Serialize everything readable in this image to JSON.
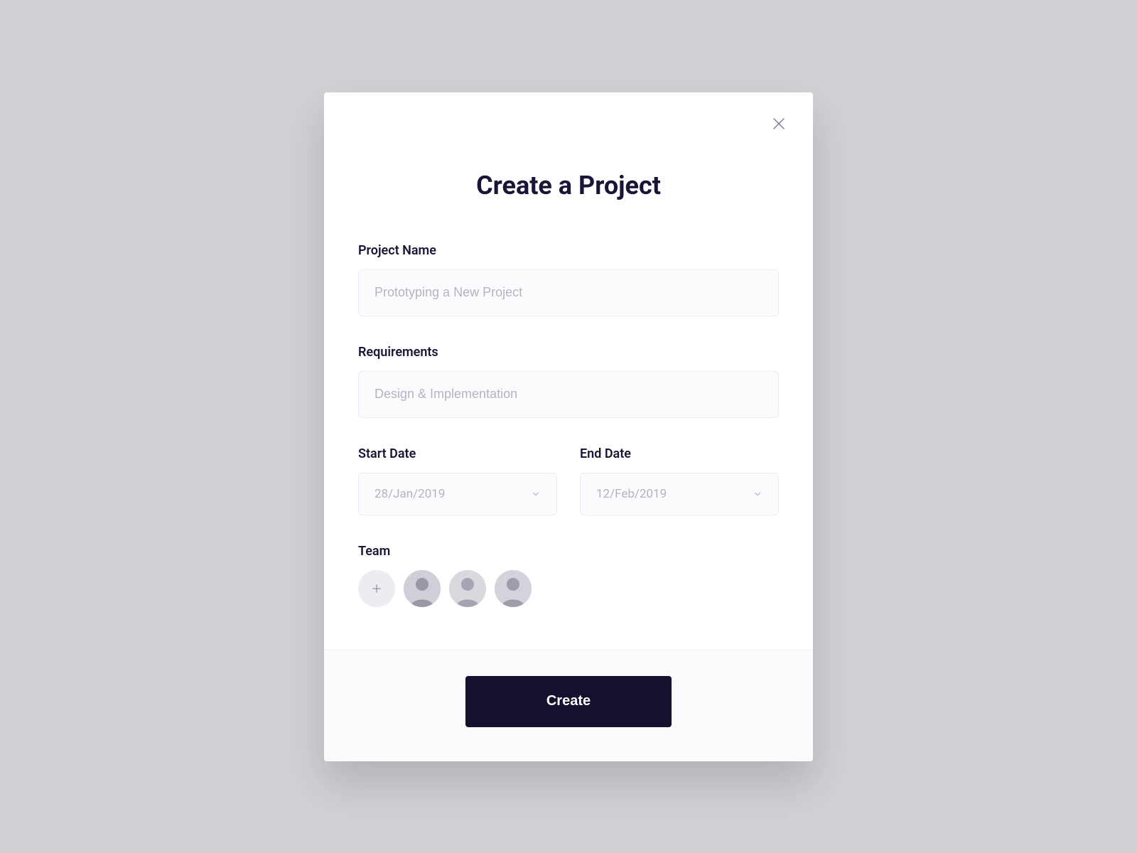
{
  "modal": {
    "title": "Create a Project",
    "close_icon": "close-icon",
    "fields": {
      "project_name": {
        "label": "Project Name",
        "placeholder": "Prototyping a New Project",
        "value": ""
      },
      "requirements": {
        "label": "Requirements",
        "placeholder": "Design & Implementation",
        "value": ""
      },
      "start_date": {
        "label": "Start Date",
        "value": "28/Jan/2019"
      },
      "end_date": {
        "label": "End Date",
        "value": "12/Feb/2019"
      },
      "team": {
        "label": "Team",
        "members": [
          {
            "name": "member-1"
          },
          {
            "name": "member-2"
          },
          {
            "name": "member-3"
          }
        ]
      }
    },
    "submit_label": "Create"
  },
  "colors": {
    "background": "#d1d0d6",
    "card": "#ffffff",
    "heading": "#1a1436",
    "placeholder": "#b5b3c1",
    "input_bg": "#fbfbfd",
    "input_border": "#ededf2",
    "button_bg": "#15102e",
    "button_text": "#ffffff"
  }
}
